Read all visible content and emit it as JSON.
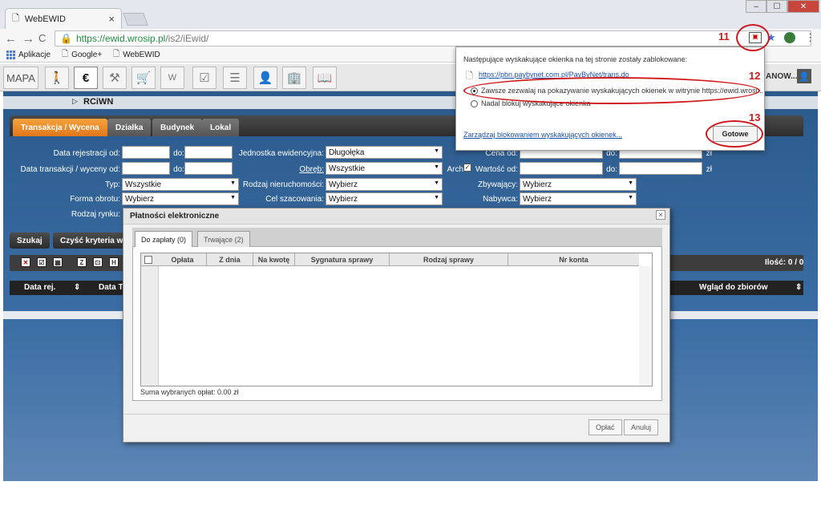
{
  "browser": {
    "tab_title": "WebEWID",
    "tab_close": "×",
    "new_tab": "",
    "window_min": "–",
    "window_max": "☐",
    "window_close": "✕",
    "nav_back": "←",
    "nav_forward": "→",
    "nav_reload": "C",
    "url_secure": "https://ewid.wrosip.pl",
    "url_path": "/is2/iEwid/",
    "bookmarks": [
      {
        "label": "Aplikacje"
      },
      {
        "label": "Google+"
      },
      {
        "label": "WebEWID"
      }
    ]
  },
  "popup_blocker": {
    "title": "Następujące wyskakujące okienka na tej stronie zostały zablokowane:",
    "blocked_url": "https://pbn.paybynet.com.pl/PayByNet/trans.do",
    "option_allow": "Zawsze zezwalaj na pokazywanie wyskakujących okienek w witrynie https://ewid.wrosi...",
    "option_block": "Nadal blokuj wyskakujące okienka",
    "manage_link": "Zarządzaj blokowaniem wyskakujących okienek...",
    "done_button": "Gotowe"
  },
  "annotations": {
    "n11": "11",
    "n12": "12",
    "n13": "13"
  },
  "app_toolbar": {
    "mapa": "MAPA",
    "user": "ANOW...",
    "icons": [
      "person-walking-icon",
      "euro-icon",
      "gavel-icon",
      "cart-icon",
      "w-icon",
      "checklist-icon",
      "list-icon",
      "user-icon",
      "building-icon",
      "book-icon"
    ]
  },
  "rciwn": "RCiWN",
  "tabs": [
    "Transakcja / Wycena",
    "Działka",
    "Budynek",
    "Lokal"
  ],
  "form": {
    "data_rej": "Data rejestracji od:",
    "do": "do:",
    "data_trans": "Data transakcji / wyceny od:",
    "typ": "Typ:",
    "typ_val": "Wszystkie",
    "forma": "Forma obrotu:",
    "forma_val": "Wybierz",
    "rodzaj_rynku": "Rodzaj rynku:",
    "jedn": "Jednostka ewidencyjna:",
    "jedn_val": "Długołęka",
    "obreb": "Obręb:",
    "obreb_val": "Wszystkie",
    "arch": "Arch",
    "rodzaj_nier": "Rodzaj nieruchomości:",
    "rodzaj_nier_val": "Wybierz",
    "cel": "Cel szacowania:",
    "cel_val": "Wybierz",
    "cena": "Cena od:",
    "wartosc": "Wartość od:",
    "zl": "zł",
    "zbywajacy": "Zbywający:",
    "zbywajacy_val": "Wybierz",
    "nabywca": "Nabywca:",
    "nabywca_val": "Wybierz"
  },
  "actions": {
    "szukaj": "Szukaj",
    "czysc": "Czyść kryteria wy"
  },
  "results": {
    "ilosc": "Ilość: 0 / 0",
    "col_data_rej": "Data rej.",
    "col_data_t": "Data T",
    "col_wglad": "Wgląd do zbiorów",
    "sort": "⇕"
  },
  "modal": {
    "title": "Płatności elektroniczne",
    "close": "×",
    "tab_do_zaplaty": "Do zapłaty (0)",
    "tab_trwajace": "Trwające (2)",
    "columns": [
      "Opłata",
      "Z dnia",
      "Na kwotę",
      "Sygnatura sprawy",
      "Rodzaj sprawy",
      "Nr konta"
    ],
    "suma": "Suma wybranych opłat: 0.00 zł",
    "oplac": "Opłać",
    "anuluj": "Anuluj"
  }
}
